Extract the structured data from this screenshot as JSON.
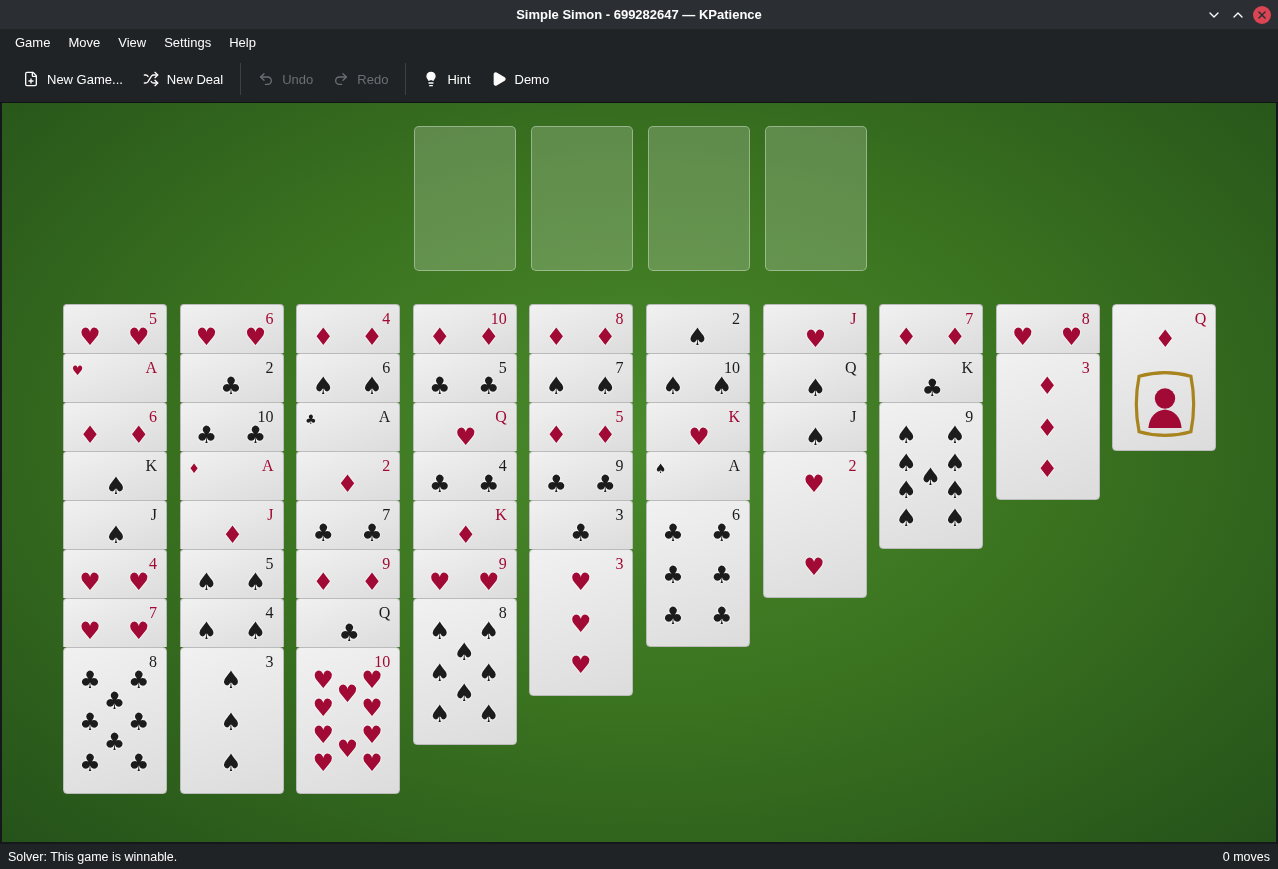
{
  "window": {
    "title": "Simple Simon - 699282647 — KPatience"
  },
  "menu": [
    "Game",
    "Move",
    "View",
    "Settings",
    "Help"
  ],
  "toolbar": [
    {
      "kind": "new-game",
      "label": "New Game...",
      "disabled": false
    },
    {
      "kind": "new-deal",
      "label": "New Deal",
      "disabled": false
    },
    {
      "kind": "separator"
    },
    {
      "kind": "undo",
      "label": "Undo",
      "disabled": true
    },
    {
      "kind": "redo",
      "label": "Redo",
      "disabled": true
    },
    {
      "kind": "separator"
    },
    {
      "kind": "hint",
      "label": "Hint",
      "disabled": false
    },
    {
      "kind": "demo",
      "label": "Demo",
      "disabled": false
    }
  ],
  "foundations": [
    {
      "kind": "empty-slot"
    },
    {
      "kind": "empty-slot"
    },
    {
      "kind": "empty-slot"
    },
    {
      "kind": "empty-slot"
    }
  ],
  "columns": [
    {
      "cards": [
        {
          "rank": "5",
          "suit": "♥",
          "color": "#a10a35"
        },
        {
          "rank": "A",
          "suit": "♥",
          "color": "#a10a35"
        },
        {
          "rank": "6",
          "suit": "♦",
          "color": "#a10a35"
        },
        {
          "rank": "K",
          "suit": "♠",
          "color": "#1c1c1c"
        },
        {
          "rank": "J",
          "suit": "♠",
          "color": "#1c1c1c"
        },
        {
          "rank": "4",
          "suit": "♥",
          "color": "#a10a35"
        },
        {
          "rank": "7",
          "suit": "♥",
          "color": "#a10a35"
        },
        {
          "rank": "8",
          "suit": "♣",
          "color": "#1c1c1c"
        }
      ]
    },
    {
      "cards": [
        {
          "rank": "6",
          "suit": "♥",
          "color": "#a10a35"
        },
        {
          "rank": "2",
          "suit": "♣",
          "color": "#1c1c1c"
        },
        {
          "rank": "10",
          "suit": "♣",
          "color": "#1c1c1c"
        },
        {
          "rank": "A",
          "suit": "♦",
          "color": "#a10a35"
        },
        {
          "rank": "J",
          "suit": "♦",
          "color": "#a10a35"
        },
        {
          "rank": "5",
          "suit": "♠",
          "color": "#1c1c1c"
        },
        {
          "rank": "4",
          "suit": "♠",
          "color": "#1c1c1c"
        },
        {
          "rank": "3",
          "suit": "♠",
          "color": "#1c1c1c"
        }
      ]
    },
    {
      "cards": [
        {
          "rank": "4",
          "suit": "♦",
          "color": "#a10a35"
        },
        {
          "rank": "6",
          "suit": "♠",
          "color": "#1c1c1c"
        },
        {
          "rank": "A",
          "suit": "♣",
          "color": "#1c1c1c"
        },
        {
          "rank": "2",
          "suit": "♦",
          "color": "#a10a35"
        },
        {
          "rank": "7",
          "suit": "♣",
          "color": "#1c1c1c"
        },
        {
          "rank": "9",
          "suit": "♦",
          "color": "#a10a35"
        },
        {
          "rank": "Q",
          "suit": "♣",
          "color": "#1c1c1c"
        },
        {
          "rank": "10",
          "suit": "♥",
          "color": "#a10a35"
        }
      ]
    },
    {
      "cards": [
        {
          "rank": "10",
          "suit": "♦",
          "color": "#a10a35"
        },
        {
          "rank": "5",
          "suit": "♣",
          "color": "#1c1c1c"
        },
        {
          "rank": "Q",
          "suit": "♥",
          "color": "#a10a35"
        },
        {
          "rank": "4",
          "suit": "♣",
          "color": "#1c1c1c"
        },
        {
          "rank": "K",
          "suit": "♦",
          "color": "#a10a35"
        },
        {
          "rank": "9",
          "suit": "♥",
          "color": "#a10a35"
        },
        {
          "rank": "8",
          "suit": "♠",
          "color": "#1c1c1c"
        }
      ]
    },
    {
      "cards": [
        {
          "rank": "8",
          "suit": "♦",
          "color": "#a10a35"
        },
        {
          "rank": "7",
          "suit": "♠",
          "color": "#1c1c1c"
        },
        {
          "rank": "5",
          "suit": "♦",
          "color": "#a10a35"
        },
        {
          "rank": "9",
          "suit": "♣",
          "color": "#1c1c1c"
        },
        {
          "rank": "3",
          "suit": "♣",
          "color": "#1c1c1c"
        },
        {
          "rank": "3",
          "suit": "♥",
          "color": "#a10a35"
        }
      ]
    },
    {
      "cards": [
        {
          "rank": "2",
          "suit": "♠",
          "color": "#1c1c1c"
        },
        {
          "rank": "10",
          "suit": "♠",
          "color": "#1c1c1c"
        },
        {
          "rank": "K",
          "suit": "♥",
          "color": "#a10a35"
        },
        {
          "rank": "A",
          "suit": "♠",
          "color": "#1c1c1c"
        },
        {
          "rank": "6",
          "suit": "♣",
          "color": "#1c1c1c"
        }
      ]
    },
    {
      "cards": [
        {
          "rank": "J",
          "suit": "♥",
          "color": "#a10a35"
        },
        {
          "rank": "Q",
          "suit": "♠",
          "color": "#1c1c1c"
        },
        {
          "rank": "J",
          "suit": "♠",
          "color": "#1c1c1c"
        },
        {
          "rank": "2",
          "suit": "♥",
          "color": "#a10a35"
        }
      ]
    },
    {
      "cards": [
        {
          "rank": "7",
          "suit": "♦",
          "color": "#a10a35"
        },
        {
          "rank": "K",
          "suit": "♣",
          "color": "#1c1c1c"
        },
        {
          "rank": "9",
          "suit": "♠",
          "color": "#1c1c1c"
        }
      ]
    },
    {
      "cards": [
        {
          "rank": "8",
          "suit": "♥",
          "color": "#a10a35"
        },
        {
          "rank": "3",
          "suit": "♦",
          "color": "#a10a35"
        }
      ]
    },
    {
      "cards": [
        {
          "rank": "Q",
          "suit": "♦",
          "color": "#a10a35"
        }
      ]
    }
  ],
  "status_bar": {
    "message": "Solver: This game is winnable.",
    "moves": "0 moves"
  }
}
